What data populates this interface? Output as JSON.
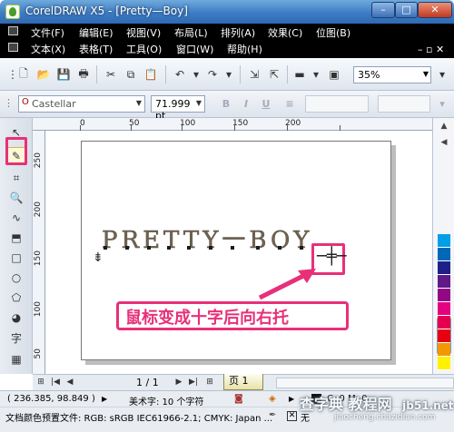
{
  "window": {
    "title": "CorelDRAW X5 - [Pretty—Boy]",
    "minimize": "–",
    "maximize": "□",
    "close": "✕"
  },
  "menu": {
    "row1": [
      "文件(F)",
      "编辑(E)",
      "视图(V)",
      "布局(L)",
      "排列(A)",
      "效果(C)",
      "位图(B)"
    ],
    "row2": [
      "文本(X)",
      "表格(T)",
      "工具(O)",
      "窗口(W)",
      "帮助(H)"
    ]
  },
  "toolbar": {
    "zoom": "35%"
  },
  "propertybar": {
    "font_name": "Castellar",
    "font_size": "71.999 pt",
    "bold": "B",
    "italic": "I",
    "underline": "U"
  },
  "ruler": {
    "h_labels": [
      "0",
      "50",
      "100",
      "150",
      "200"
    ],
    "v_labels": [
      "250",
      "200",
      "150",
      "100",
      "50"
    ]
  },
  "canvas": {
    "art_text": "PRETTY一BOY",
    "annotation": "鼠标变成十字后向右托",
    "cursor_glyph": "─╪─"
  },
  "pagebar": {
    "counter": "1 / 1",
    "page_tab": "页 1"
  },
  "status": {
    "coords": "( 236.385, 98.849 )",
    "object_info": "美术字: 10 个字符",
    "fill_info": "C: 0 M: 0",
    "color_profile": "文档颜色预置文件: RGB: sRGB IEC61966-2.1; CMYK: Japan ...",
    "outline_info": "无"
  },
  "watermark": {
    "main": "查字典 教程网",
    "domain": "jb51.net",
    "sub": "jiaocheng.chazidian.com"
  },
  "colors": {
    "highlight": "#e8307a",
    "menubar_bg": "#000000",
    "titlebar": "#3d7cc4"
  },
  "palette": [
    "#00a0e9",
    "#0068b7",
    "#1d2088",
    "#601986",
    "#920783",
    "#e4007f",
    "#e5004f",
    "#e60012",
    "#f39800",
    "#fff100"
  ]
}
